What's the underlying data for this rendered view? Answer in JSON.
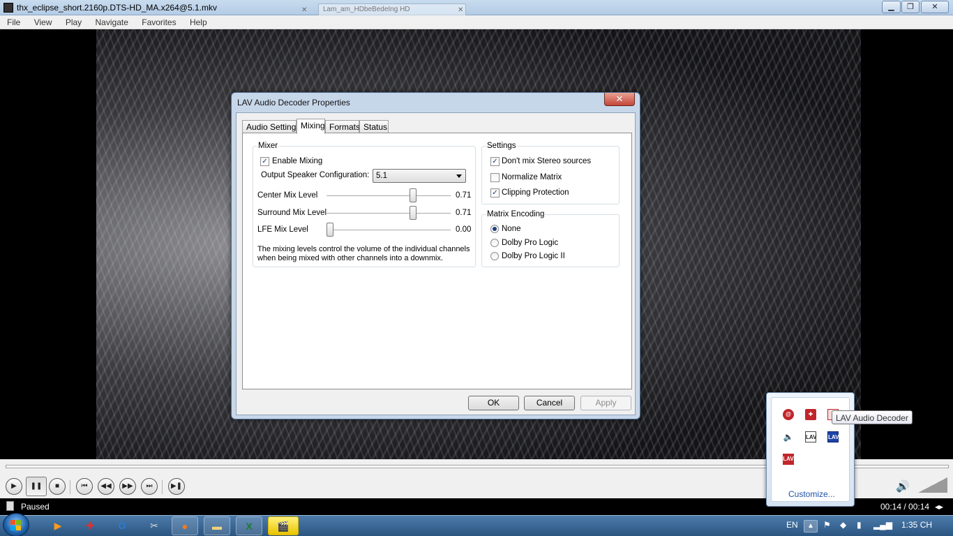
{
  "window": {
    "title": "thx_eclipse_short.2160p.DTS-HD_MA.x264@5.1.mkv",
    "ghost_tab_title": "Lam_am_HDbeBedeIng HD",
    "minimize": "▁",
    "maximize": "❐",
    "close": "✕"
  },
  "menu": [
    "File",
    "View",
    "Play",
    "Navigate",
    "Favorites",
    "Help"
  ],
  "dialog": {
    "title": "LAV Audio Decoder Properties",
    "close": "✕",
    "tabs": [
      "Audio Settings",
      "Mixing",
      "Formats",
      "Status"
    ],
    "active_tab": "Mixing",
    "mixer": {
      "group_label": "Mixer",
      "enable_mixing_label": "Enable Mixing",
      "enable_mixing_checked": true,
      "check_mark": "✓",
      "speaker_config_label": "Output Speaker Configuration:",
      "speaker_config_value": "5.1",
      "center_label": "Center Mix Level",
      "center_value": "0.71",
      "center_level": 0.71,
      "surround_label": "Surround Mix Level",
      "surround_value": "0.71",
      "surround_level": 0.71,
      "lfe_label": "LFE Mix Level",
      "lfe_value": "0.00",
      "lfe_level": 0.0,
      "note": "The mixing levels control the volume of the individual channels when being mixed with other channels into a downmix."
    },
    "settings": {
      "group_label": "Settings",
      "dont_mix_label": "Don't mix Stereo sources",
      "dont_mix_checked": true,
      "normalize_label": "Normalize Matrix",
      "normalize_checked": false,
      "clipping_label": "Clipping Protection",
      "clipping_checked": true
    },
    "matrix": {
      "group_label": "Matrix Encoding",
      "options": [
        "None",
        "Dolby Pro Logic",
        "Dolby Pro Logic II"
      ],
      "selected": "None"
    },
    "buttons": {
      "ok": "OK",
      "cancel": "Cancel",
      "apply": "Apply"
    }
  },
  "player": {
    "status": "Paused",
    "time": "00:14 / 00:14",
    "controls": {
      "play": "▶",
      "pause": "❚❚",
      "stop": "■",
      "prev": "⏮",
      "rewind": "◀◀",
      "forward": "▶▶",
      "next": "⏭",
      "frame_step": "▶❚"
    }
  },
  "tray_popup": {
    "customize_label": "Customize...",
    "tooltip": "LAV Audio Decoder",
    "icon_text": "LAV"
  },
  "taskbar": {
    "language": "EN",
    "clock": "1:35 CH"
  },
  "colors": {
    "taskbar": "#2b5581",
    "link": "#1f52a8",
    "lav_red": "#c0262b",
    "lav_blue": "#1d43a8"
  }
}
